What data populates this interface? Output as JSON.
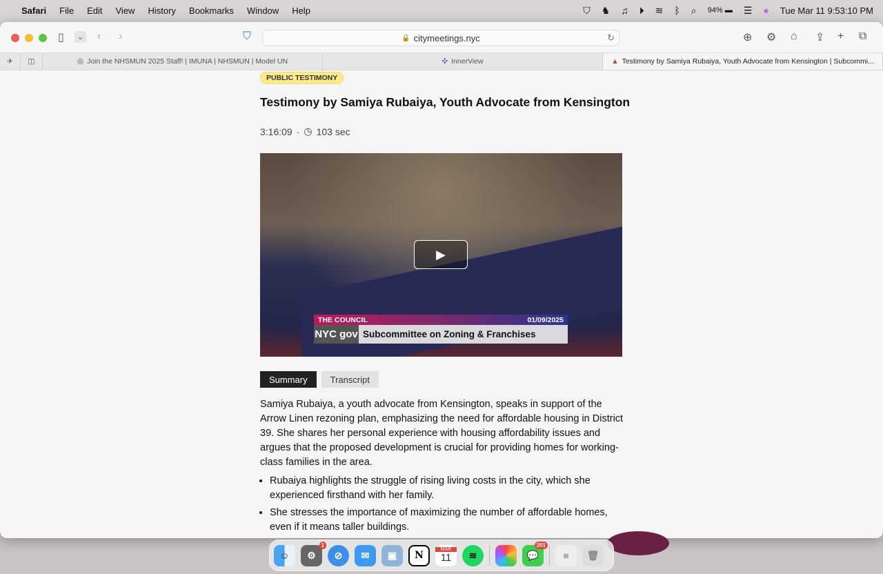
{
  "menubar": {
    "app": "Safari",
    "items": [
      "File",
      "Edit",
      "View",
      "History",
      "Bookmarks",
      "Window",
      "Help"
    ],
    "battery": "94%",
    "datetime": "Tue Mar 11  9:53:10 PM"
  },
  "browser": {
    "url": "citymeetings.nyc",
    "tabs": [
      {
        "title": "Join the NHSMUN 2025 Staff! | IMUNA | NHSMUN | Model UN"
      },
      {
        "title": "InnerView"
      },
      {
        "title": "Testimony by Samiya Rubaiya, Youth Advocate from Kensington | Subcommi..."
      }
    ]
  },
  "page": {
    "badge": "PUBLIC TESTIMONY",
    "title": "Testimony by Samiya Rubaiya, Youth Advocate from Kensington",
    "timestamp": "3:16:09",
    "separator": "·",
    "duration": "103 sec",
    "video": {
      "banner_left": "THE COUNCIL",
      "banner_date": "01/09/2025",
      "logo": "NYC gov",
      "caption": "Subcommittee on Zoning & Franchises"
    },
    "tabs": [
      "Summary",
      "Transcript"
    ],
    "summary": "Samiya Rubaiya, a youth advocate from Kensington, speaks in support of the Arrow Linen rezoning plan, emphasizing the need for affordable housing in District 39. She shares her personal experience with housing affordability issues and argues that the proposed development is crucial for providing homes for working-class families in the area.",
    "bullets": [
      "Rubaiya highlights the struggle of rising living costs in the city, which she experienced firsthand with her family.",
      "She stresses the importance of maximizing the number of affordable homes, even if it means taller buildings."
    ]
  },
  "dock": {
    "calendar_month": "MAR",
    "calendar_day": "11",
    "settings_badge": "1",
    "messages_badge": "201"
  }
}
